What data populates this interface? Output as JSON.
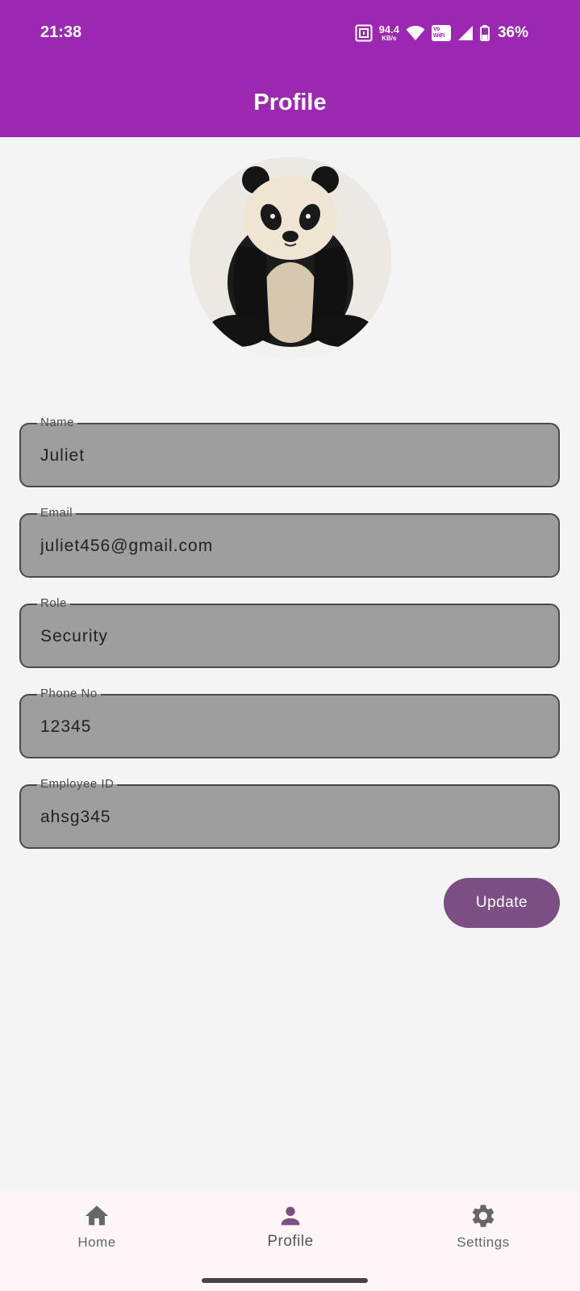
{
  "status": {
    "time": "21:38",
    "net_speed": "94.4",
    "net_unit": "KB/s",
    "vowifi_line1": "Vo",
    "vowifi_line2": "WiFi",
    "battery": "36%"
  },
  "app_bar": {
    "title": "Profile"
  },
  "form": {
    "name": {
      "label": "Name",
      "value": "Juliet"
    },
    "email": {
      "label": "Email",
      "value": "juliet456@gmail.com"
    },
    "role": {
      "label": "Role",
      "value": "Security"
    },
    "phone": {
      "label": "Phone No",
      "value": "12345"
    },
    "employee_id": {
      "label": "Employee ID",
      "value": "ahsg345"
    }
  },
  "actions": {
    "update_label": "Update"
  },
  "bottom_nav": {
    "home": {
      "label": "Home",
      "icon": "home-icon"
    },
    "profile": {
      "label": "Profile",
      "icon": "person-icon"
    },
    "settings": {
      "label": "Settings",
      "icon": "gear-icon"
    }
  },
  "colors": {
    "primary": "#9c27b0",
    "button": "#7b4f83",
    "field_bg": "#9e9e9e",
    "nav_active": "#7b4f83",
    "nav_inactive": "#666666"
  }
}
